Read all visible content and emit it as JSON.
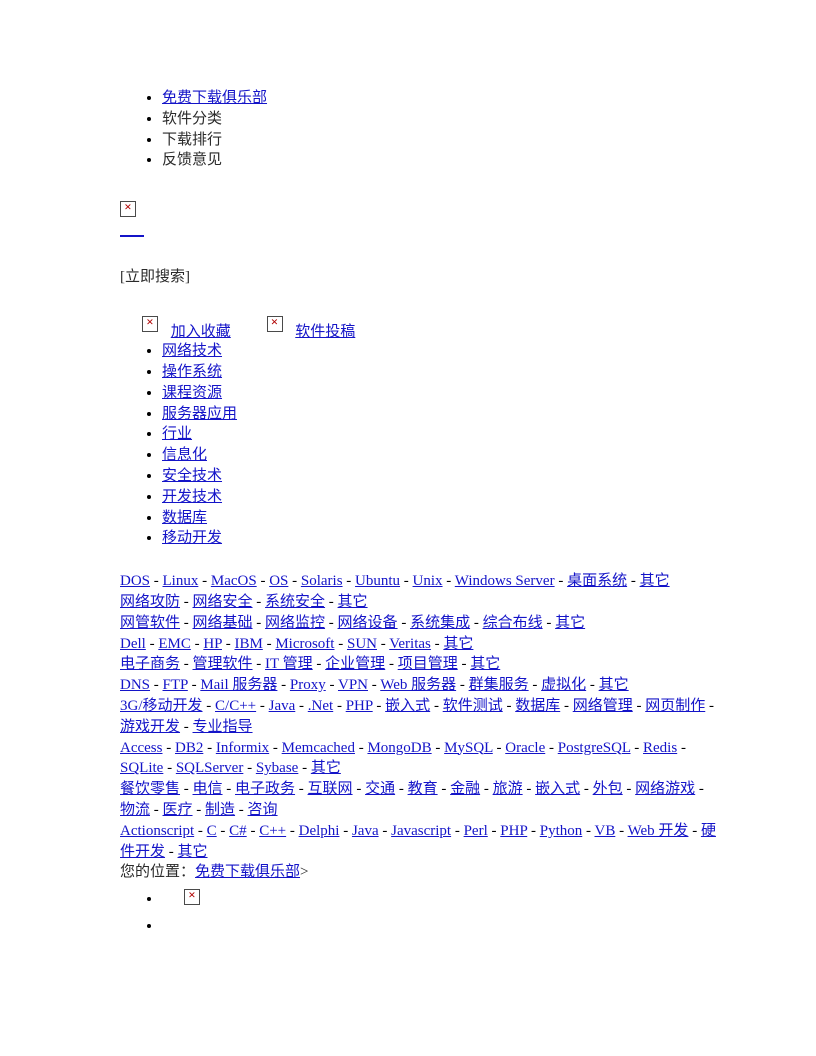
{
  "top_nav": [
    {
      "label": "免费下载俱乐部",
      "is_link": true
    },
    {
      "label": "软件分类",
      "is_link": false
    },
    {
      "label": "下载排行",
      "is_link": false
    },
    {
      "label": "反馈意见",
      "is_link": false
    }
  ],
  "search": {
    "button_label": "[立即搜索]",
    "logo_icon": "broken-image-icon",
    "empty_link_label": ""
  },
  "favorites": {
    "add_favorite_icon": "broken-image-icon",
    "add_favorite_label": "加入收藏",
    "submit_software_icon": "broken-image-icon",
    "submit_software_label": "软件投稿"
  },
  "categories": [
    "网络技术",
    "操作系统",
    "课程资源",
    "服务器应用",
    "行业",
    "信息化",
    "安全技术",
    "开发技术",
    "数据库",
    "移动开发"
  ],
  "link_rows": [
    {
      "name": "operating-systems",
      "items": [
        "DOS",
        "Linux",
        "MacOS",
        "OS",
        "Solaris",
        "Ubuntu",
        "Unix",
        "Windows Server",
        "桌面系统",
        "其它"
      ]
    },
    {
      "name": "security",
      "items": [
        "网络攻防",
        "网络安全",
        "系统安全",
        "其它"
      ]
    },
    {
      "name": "network-tech",
      "items": [
        "网管软件",
        "网络基础",
        "网络监控",
        "网络设备",
        "系统集成",
        "综合布线",
        "其它"
      ]
    },
    {
      "name": "vendors",
      "items": [
        "Dell",
        "EMC",
        "HP",
        "IBM",
        "Microsoft",
        "SUN",
        "Veritas",
        "其它"
      ]
    },
    {
      "name": "informatization",
      "items": [
        "电子商务",
        "管理软件",
        "IT 管理",
        "企业管理",
        "项目管理",
        "其它"
      ]
    },
    {
      "name": "server-apps",
      "items": [
        "DNS",
        "FTP",
        "Mail 服务器",
        "Proxy",
        "VPN",
        "Web 服务器",
        "群集服务",
        "虚拟化",
        "其它"
      ]
    },
    {
      "name": "courses",
      "items": [
        "3G/移动开发",
        "C/C++",
        "Java",
        ".Net",
        "PHP",
        "嵌入式",
        "软件测试",
        "数据库",
        "网络管理",
        "网页制作",
        "游戏开发",
        "专业指导"
      ]
    },
    {
      "name": "databases",
      "items": [
        "Access",
        "DB2",
        "Informix",
        "Memcached",
        "MongoDB",
        "MySQL",
        "Oracle",
        "PostgreSQL",
        "Redis",
        "SQLite",
        "SQLServer",
        "Sybase",
        "其它"
      ]
    },
    {
      "name": "industries",
      "items": [
        "餐饮零售",
        "电信",
        "电子政务",
        "互联网",
        "交通",
        "教育",
        "金融",
        "旅游",
        "嵌入式",
        "外包",
        "网络游戏",
        "物流",
        "医疗",
        "制造",
        "咨询"
      ]
    },
    {
      "name": "development",
      "items": [
        "Actionscript",
        "C",
        "C#",
        "C++",
        "Delphi",
        "Java",
        "Javascript",
        "Perl",
        "PHP",
        "Python",
        "VB",
        "Web 开发",
        "硬件开发",
        "其它"
      ]
    }
  ],
  "breadcrumb": {
    "prefix": "您的位置：",
    "home_label": "免费下载俱乐部",
    "suffix": ">"
  },
  "bottom_list": {
    "item_icon": "broken-image-icon"
  },
  "separator": " - ",
  "colors": {
    "link": "#1414c8",
    "text": "#000000",
    "broken_icon_x": "#b00000"
  }
}
